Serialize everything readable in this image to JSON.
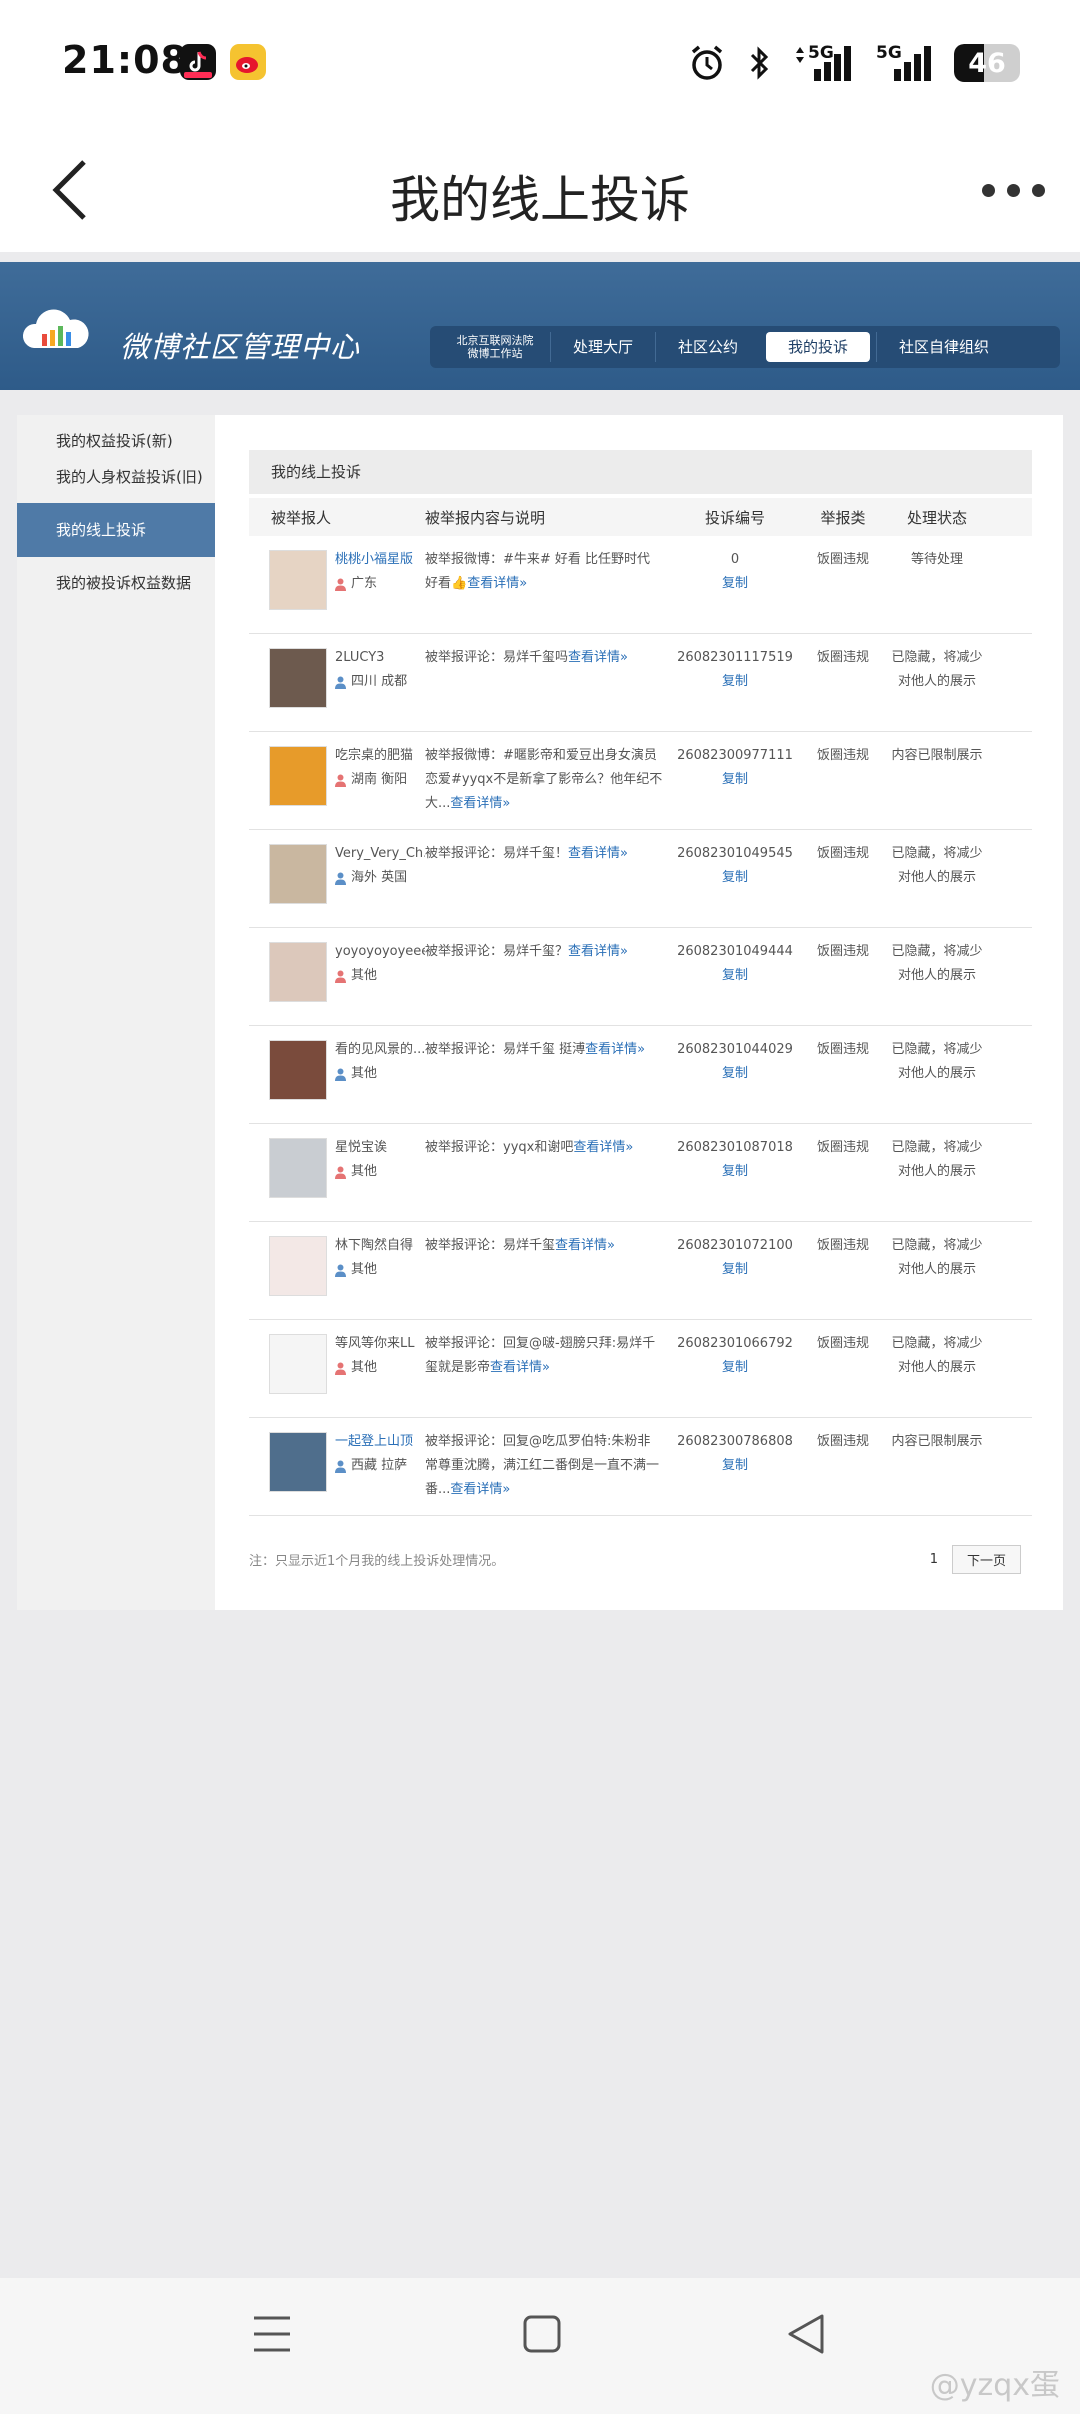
{
  "status_bar": {
    "time": "21:08",
    "battery": "46",
    "battery_level": 0.46,
    "signal_label_1": "5G",
    "signal_label_2": "5G"
  },
  "title_bar": {
    "title": "我的线上投诉"
  },
  "site": {
    "brand": "微博社区管理中心",
    "nav_special": [
      "北京互联网法院",
      "微博工作站"
    ],
    "nav": [
      "处理大厅",
      "社区公约",
      "我的投诉",
      "社区自律组织"
    ],
    "active_nav": "我的投诉"
  },
  "sidebar": {
    "items": [
      "我的权益投诉(新)",
      "我的人身权益投诉(旧)",
      "我的线上投诉",
      "我的被投诉权益数据"
    ]
  },
  "content": {
    "heading": "我的线上投诉",
    "columns": [
      "被举报人",
      "被举报内容与说明",
      "投诉编号",
      "举报类",
      "处理状态"
    ],
    "copy_label": "复制",
    "rows": [
      {
        "name": "桃桃小福星版",
        "location": "广东",
        "content": "被举报微博：#牛来# 好看 比任野时代好看👍",
        "detail": "查看详情»",
        "id": "0",
        "type": "饭圈违规",
        "status": "等待处理",
        "avatar_color": "#e6d4c4"
      },
      {
        "name": "2LUCY3",
        "location": "四川 成都",
        "content": "被举报评论：易烊千玺吗",
        "detail": "查看详情»",
        "id": "26082301117519",
        "type": "饭圈违规",
        "status": "已隐藏，将减少对他人的展示",
        "avatar_color": "#6d5a4e"
      },
      {
        "name": "吃宗桌的肥猫",
        "location": "湖南 衡阳",
        "content": "被举报微博：#暱影帝和爱豆出身女演员恋爱#yyqx不是新拿了影帝么？他年纪不大...",
        "detail": "查看详情»",
        "id": "26082300977111",
        "type": "饭圈违规",
        "status": "内容已限制展示",
        "avatar_color": "#e79b2a"
      },
      {
        "name": "Very_Very_Ch...",
        "location": "海外 英国",
        "content": "被举报评论：易烊千玺！",
        "detail": "查看详情»",
        "id": "26082301049545",
        "type": "饭圈违规",
        "status": "已隐藏，将减少对他人的展示",
        "avatar_color": "#c9b7a0"
      },
      {
        "name": "yoyoyoyoyeee",
        "location": "其他",
        "content": "被举报评论：易烊千玺？",
        "detail": "查看详情»",
        "id": "26082301049444",
        "type": "饭圈违规",
        "status": "已隐藏，将减少对他人的展示",
        "avatar_color": "#dcc8bb"
      },
      {
        "name": "看的见风景的...",
        "location": "其他",
        "content": "被举报评论：易烊千玺 挺溥",
        "detail": "查看详情»",
        "id": "26082301044029",
        "type": "饭圈违规",
        "status": "已隐藏，将减少对他人的展示",
        "avatar_color": "#7a4b3c"
      },
      {
        "name": "星悦宝诶",
        "location": "其他",
        "content": "被举报评论：yyqx和谢吧",
        "detail": "查看详情»",
        "id": "26082301087018",
        "type": "饭圈违规",
        "status": "已隐藏，将减少对他人的展示",
        "avatar_color": "#c9cdd2"
      },
      {
        "name": "林下陶然自得",
        "location": "其他",
        "content": "被举报评论：易烊千玺",
        "detail": "查看详情»",
        "id": "26082301072100",
        "type": "饭圈违规",
        "status": "已隐藏，将减少对他人的展示",
        "avatar_color": "#f3e8e6"
      },
      {
        "name": "等风等你来LL",
        "location": "其他",
        "content": "被举报评论：回复@啵-翅膀只拜:易烊千玺就是影帝",
        "detail": "查看详情»",
        "id": "26082301066792",
        "type": "饭圈违规",
        "status": "已隐藏，将减少对他人的展示",
        "avatar_color": "#f5f5f5"
      },
      {
        "name": "一起登上山顶",
        "location": "西藏 拉萨",
        "content": "被举报评论：回复@吃瓜罗伯特:朱粉非常尊重沈腾，满江红二番倒是一直不满一番...",
        "detail": "查看详情»",
        "id": "26082300786808",
        "type": "饭圈违规",
        "status": "内容已限制展示",
        "avatar_color": "#4f6e8c"
      }
    ],
    "footer_note": "注：只显示近1个月我的线上投诉处理情况。",
    "page": "1",
    "next_label": "下一页"
  },
  "watermark": "@yzqx蛋"
}
